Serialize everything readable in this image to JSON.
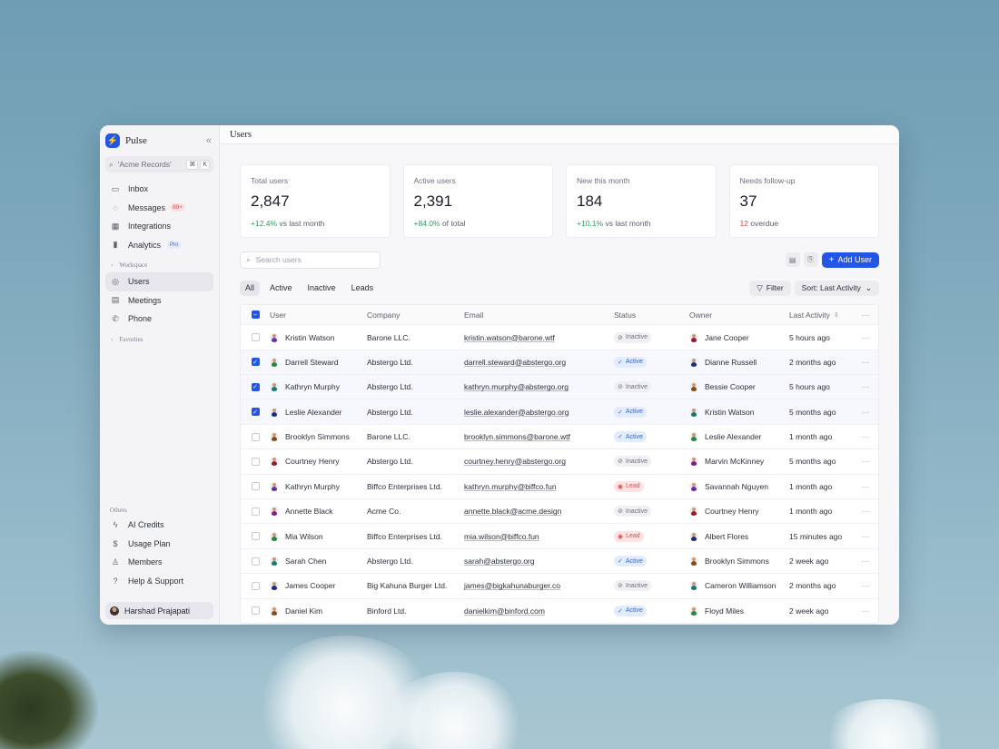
{
  "app": {
    "name": "Pulse"
  },
  "sidebar": {
    "search_placeholder": "'Acme Records'",
    "shortcut": [
      "⌘",
      "K"
    ],
    "primary": [
      {
        "label": "Inbox",
        "icon": "inbox-icon"
      },
      {
        "label": "Messages",
        "icon": "message-icon",
        "badge": "99+"
      },
      {
        "label": "Integrations",
        "icon": "grid-icon"
      },
      {
        "label": "Analytics",
        "icon": "chart-icon",
        "badge": "Pro"
      }
    ],
    "workspace_label": "Workspace",
    "workspace": [
      {
        "label": "Users",
        "icon": "user-circle-icon",
        "active": true
      },
      {
        "label": "Meetings",
        "icon": "calendar-icon"
      },
      {
        "label": "Phone",
        "icon": "phone-icon"
      }
    ],
    "favorites_label": "Favorites",
    "others_label": "Others",
    "others": [
      {
        "label": "AI Credits",
        "icon": "bolt-icon"
      },
      {
        "label": "Usage Plan",
        "icon": "dollar-icon"
      },
      {
        "label": "Members",
        "icon": "members-icon"
      },
      {
        "label": "Help & Support",
        "icon": "help-icon"
      }
    ],
    "profile_name": "Harshad Prajapati"
  },
  "header": {
    "title": "Users"
  },
  "stats": [
    {
      "label": "Total users",
      "value": "2,847",
      "delta": "+12.4%",
      "delta_text": "vs last month",
      "tone": "pos"
    },
    {
      "label": "Active users",
      "value": "2,391",
      "delta": "+84.0%",
      "delta_text": "of total",
      "tone": "pos"
    },
    {
      "label": "New this month",
      "value": "184",
      "delta": "+10.1%",
      "delta_text": "vs last month",
      "tone": "pos"
    },
    {
      "label": "Needs follow-up",
      "value": "37",
      "delta": "12",
      "delta_text": "overdue",
      "tone": "neg"
    }
  ],
  "toolbar": {
    "search_placeholder": "Search users",
    "add_label": "Add User",
    "tabs": [
      "All",
      "Active",
      "Inactive",
      "Leads"
    ],
    "active_tab": 0,
    "filter_label": "Filter",
    "sort_label": "Sort: Last Activity"
  },
  "table": {
    "columns": [
      "User",
      "Company",
      "Email",
      "Status",
      "Owner",
      "Last Activity"
    ],
    "rows": [
      {
        "checked": false,
        "user": "Kristin Watson",
        "user_color": "#6a2bb0",
        "company": "Barone LLC.",
        "email": "kristin.watson@barone.wtf",
        "status": "Inactive",
        "owner": "Jane Cooper",
        "owner_color": "#9a1a2a",
        "last": "5 hours ago"
      },
      {
        "checked": true,
        "user": "Darrell Steward",
        "user_color": "#1f8a3b",
        "company": "Abstergo Ltd.",
        "email": "darrell.steward@abstergo.org",
        "status": "Active",
        "owner": "Dianne Russell",
        "owner_color": "#1a2a8a",
        "last": "2 months ago"
      },
      {
        "checked": true,
        "user": "Kathryn Murphy",
        "user_color": "#137a72",
        "company": "Abstergo Ltd.",
        "email": "kathryn.murphy@abstergo.org",
        "status": "Inactive",
        "owner": "Bessie Cooper",
        "owner_color": "#8a4a12",
        "last": "5 hours ago"
      },
      {
        "checked": true,
        "user": "Leslie Alexander",
        "user_color": "#1a2a8a",
        "company": "Abstergo Ltd.",
        "email": "leslie.alexander@abstergo.org",
        "status": "Active",
        "owner": "Kristin Watson",
        "owner_color": "#137a72",
        "last": "5 months ago"
      },
      {
        "checked": false,
        "user": "Brooklyn Simmons",
        "user_color": "#8a4a12",
        "company": "Barone LLC.",
        "email": "brooklyn.simmons@barone.wtf",
        "status": "Active",
        "owner": "Leslie Alexander",
        "owner_color": "#1f8a3b",
        "last": "1 month ago"
      },
      {
        "checked": false,
        "user": "Courtney Henry",
        "user_color": "#9a1a2a",
        "company": "Abstergo Ltd.",
        "email": "courtney.henry@abstergo.org",
        "status": "Inactive",
        "owner": "Marvin McKinney",
        "owner_color": "#8a1a8a",
        "last": "5 months ago"
      },
      {
        "checked": false,
        "user": "Kathryn Murphy",
        "user_color": "#6a2bb0",
        "company": "Biffco Enterprises Ltd.",
        "email": "kathryn.murphy@biffco.fun",
        "status": "Lead",
        "owner": "Savannah Nguyen",
        "owner_color": "#6a2bb0",
        "last": "1 month ago"
      },
      {
        "checked": false,
        "user": "Annette Black",
        "user_color": "#8a1a8a",
        "company": "Acme Co.",
        "email": "annette.black@acme.design",
        "status": "Inactive",
        "owner": "Courtney Henry",
        "owner_color": "#9a1a2a",
        "last": "1 month ago"
      },
      {
        "checked": false,
        "user": "Mia Wilson",
        "user_color": "#1f8a3b",
        "company": "Biffco Enterprises Ltd.",
        "email": "mia.wilson@biffco.fun",
        "status": "Lead",
        "owner": "Albert Flores",
        "owner_color": "#1a2a8a",
        "last": "15 minutes ago"
      },
      {
        "checked": false,
        "user": "Sarah Chen",
        "user_color": "#137a72",
        "company": "Abstergo Ltd.",
        "email": "sarah@abstergo.org",
        "status": "Active",
        "owner": "Brooklyn Simmons",
        "owner_color": "#8a4a12",
        "last": "2 week ago"
      },
      {
        "checked": false,
        "user": "James Cooper",
        "user_color": "#1a2a8a",
        "company": "Big Kahuna Burger Ltd.",
        "email": "james@bigkahunaburger.co",
        "status": "Inactive",
        "owner": "Cameron Williamson",
        "owner_color": "#137a72",
        "last": "2 months ago"
      },
      {
        "checked": false,
        "user": "Daniel Kim",
        "user_color": "#8a4a12",
        "company": "Binford Ltd.",
        "email": "danielkim@binford.com",
        "status": "Active",
        "owner": "Floyd Miles",
        "owner_color": "#1f8a3b",
        "last": "2 week ago"
      }
    ]
  },
  "colors": {
    "accent": "#2456e6",
    "positive": "#2f9e5a",
    "negative": "#e04848"
  }
}
